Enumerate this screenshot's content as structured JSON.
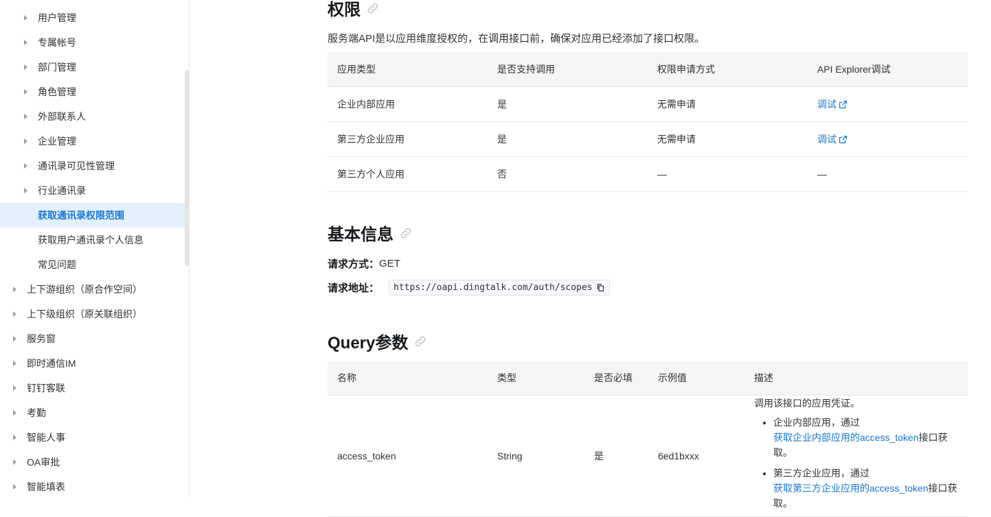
{
  "sidebar": {
    "items": [
      {
        "label": "用户管理",
        "level": 2,
        "caret": true
      },
      {
        "label": "专属帐号",
        "level": 2,
        "caret": true
      },
      {
        "label": "部门管理",
        "level": 2,
        "caret": true
      },
      {
        "label": "角色管理",
        "level": 2,
        "caret": true
      },
      {
        "label": "外部联系人",
        "level": 2,
        "caret": true
      },
      {
        "label": "企业管理",
        "level": 2,
        "caret": true
      },
      {
        "label": "通讯录可见性管理",
        "level": 2,
        "caret": true
      },
      {
        "label": "行业通讯录",
        "level": 2,
        "caret": true
      },
      {
        "label": "获取通讯录权限范围",
        "level": 2,
        "caret": false,
        "active": true
      },
      {
        "label": "获取用户通讯录个人信息",
        "level": 2,
        "caret": false
      },
      {
        "label": "常见问题",
        "level": 2,
        "caret": false
      },
      {
        "label": "上下游组织（原合作空间）",
        "level": 1,
        "caret": true
      },
      {
        "label": "上下级组织（原关联组织）",
        "level": 1,
        "caret": true
      },
      {
        "label": "服务窗",
        "level": 1,
        "caret": true
      },
      {
        "label": "即时通信IM",
        "level": 1,
        "caret": true
      },
      {
        "label": "钉钉客联",
        "level": 1,
        "caret": true
      },
      {
        "label": "考勤",
        "level": 1,
        "caret": true
      },
      {
        "label": "智能人事",
        "level": 1,
        "caret": true
      },
      {
        "label": "OA审批",
        "level": 1,
        "caret": true
      },
      {
        "label": "智能填表",
        "level": 1,
        "caret": true
      }
    ]
  },
  "permissions": {
    "title": "权限",
    "description": "服务端API是以应用维度授权的，在调用接口前，确保对应用已经添加了接口权限。",
    "headers": [
      "应用类型",
      "是否支持调用",
      "权限申请方式",
      "API Explorer调试"
    ],
    "rows": [
      {
        "type": "企业内部应用",
        "supported": "是",
        "apply": "无需申请",
        "debug": "调试",
        "debug_link": true
      },
      {
        "type": "第三方企业应用",
        "supported": "是",
        "apply": "无需申请",
        "debug": "调试",
        "debug_link": true
      },
      {
        "type": "第三方个人应用",
        "supported": "否",
        "apply": "—",
        "debug": "—",
        "debug_link": false
      }
    ]
  },
  "basic": {
    "title": "基本信息",
    "method_label": "请求方式：",
    "method_value": "GET",
    "url_label": "请求地址：",
    "url_value": "https://oapi.dingtalk.com/auth/scopes"
  },
  "query": {
    "title": "Query参数",
    "headers": [
      "名称",
      "类型",
      "是否必填",
      "示例值",
      "描述"
    ],
    "row": {
      "name": "access_token",
      "type": "String",
      "required": "是",
      "example": "6ed1bxxx",
      "desc_intro": "调用该接口的应用凭证。",
      "bullet1_prefix": "企业内部应用，通过",
      "bullet1_link": "获取企业内部应用的access_token",
      "bullet1_suffix": "接口获取。",
      "bullet2_prefix": "第三方企业应用，通过",
      "bullet2_link": "获取第三方企业应用的access_token",
      "bullet2_suffix": "接口获取。"
    }
  },
  "colors": {
    "accent": "#1677d6",
    "active_bg": "#e5f0fd",
    "header_bg": "#f4f5f6"
  },
  "icons": {
    "anchor": "link-icon",
    "external": "external-link-icon",
    "copy": "copy-icon",
    "caret": "caret-right-icon"
  }
}
